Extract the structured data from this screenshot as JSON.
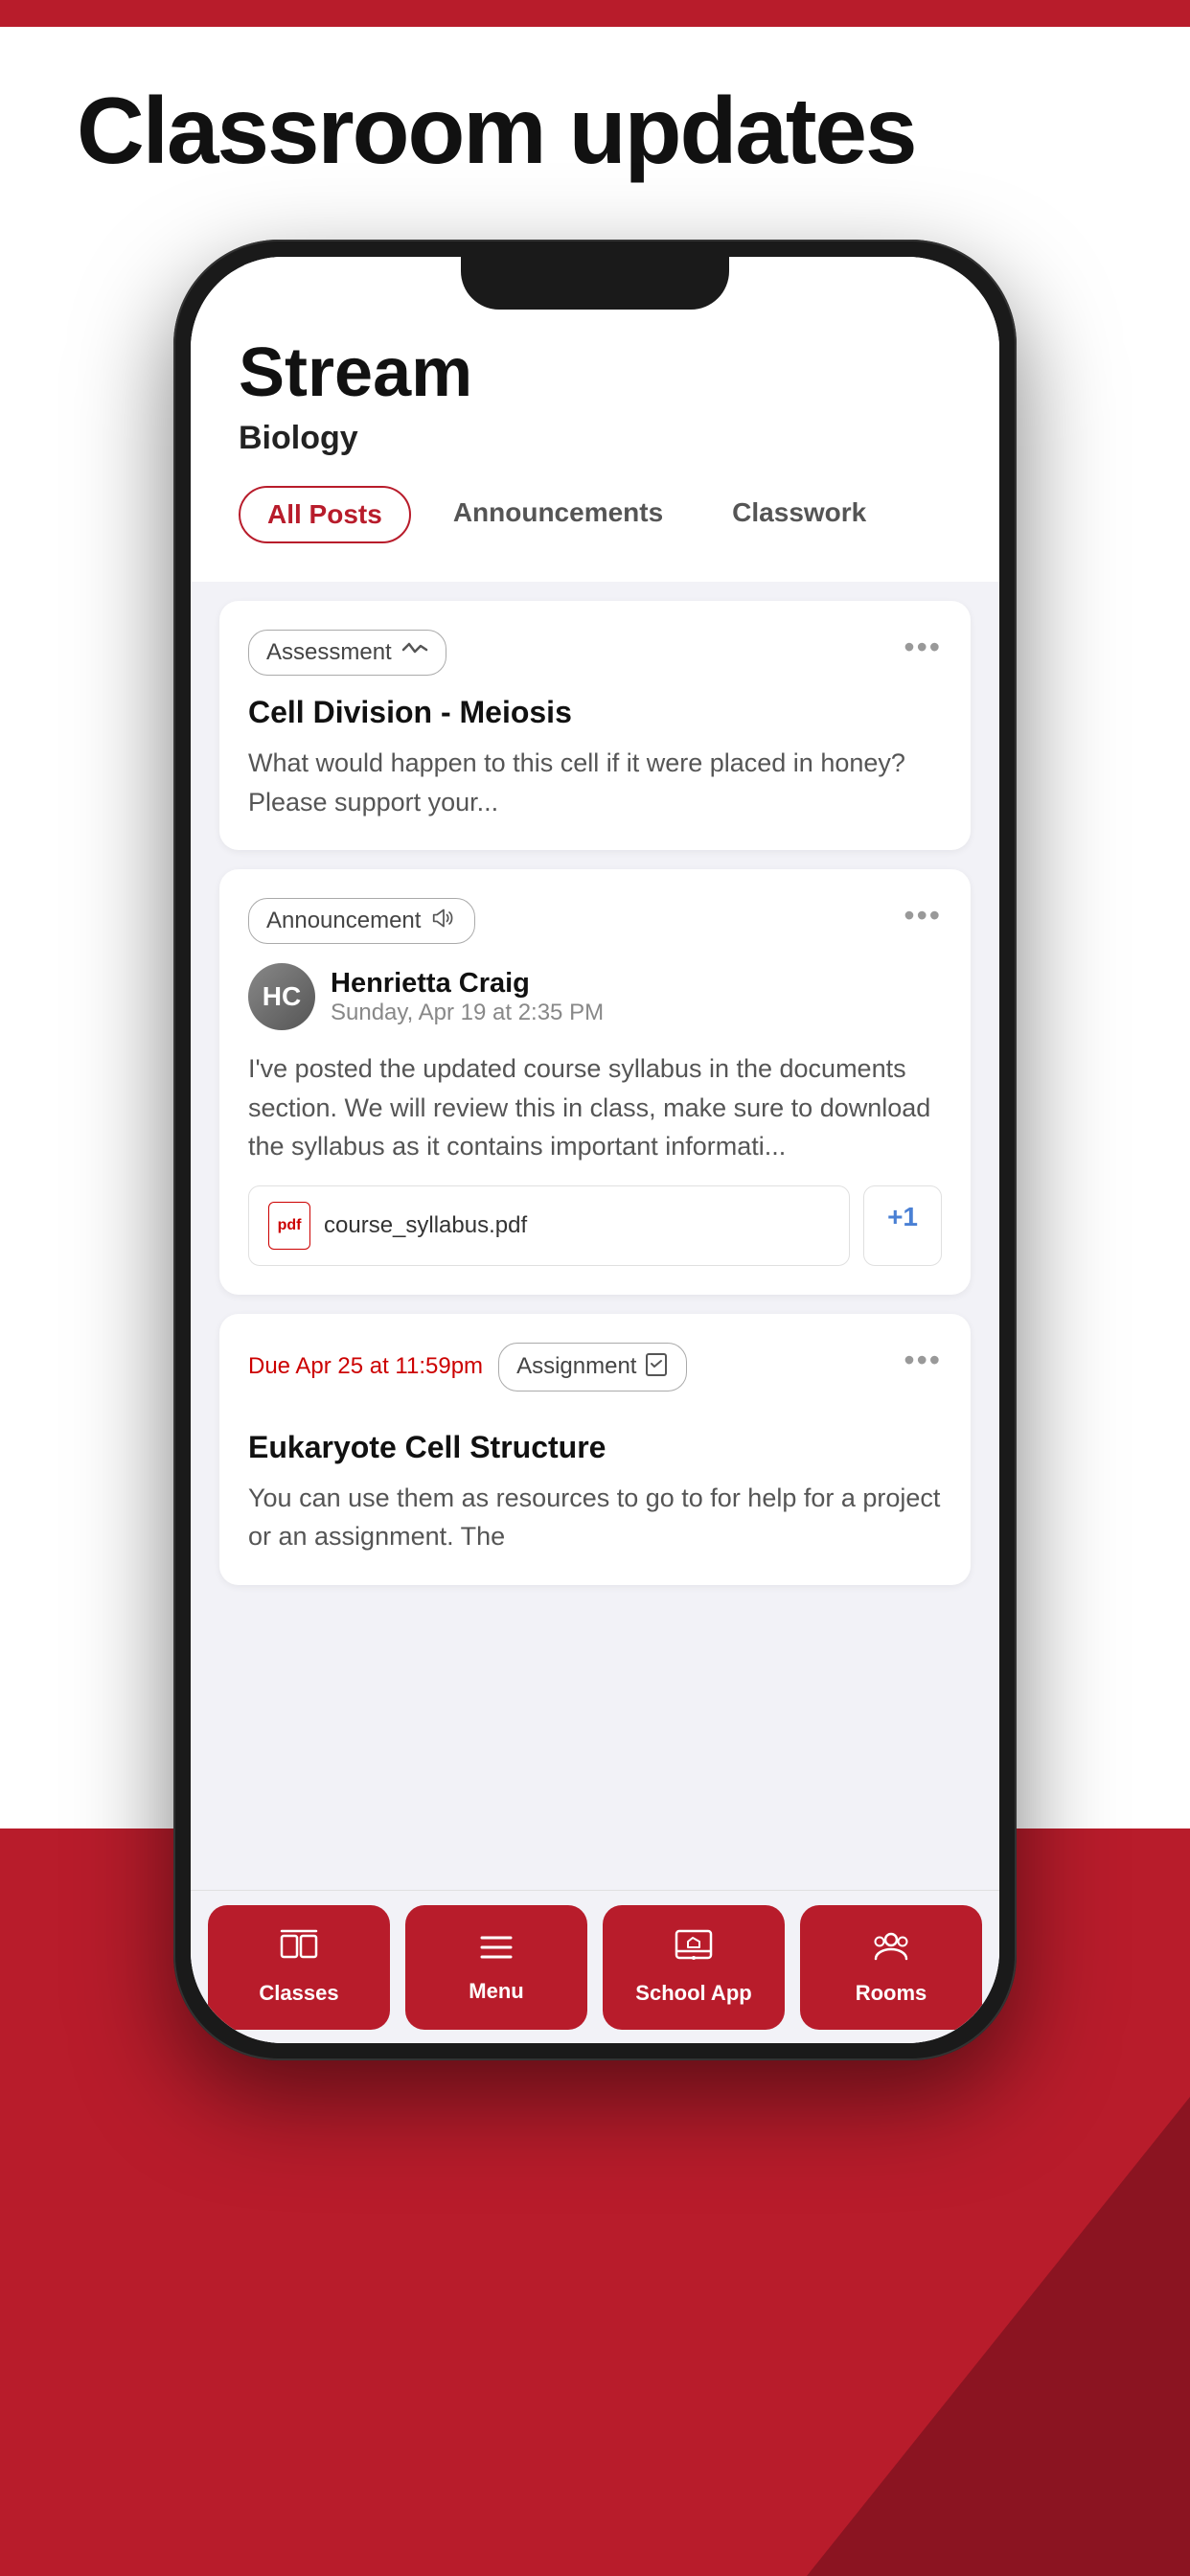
{
  "page": {
    "title": "Classroom updates",
    "background_top_color": "#b81c2b",
    "background_bottom_color": "#b81c2b"
  },
  "phone": {
    "screen": {
      "header": {
        "stream_title": "Stream",
        "class_name": "Biology"
      },
      "filter_tabs": [
        {
          "id": "all_posts",
          "label": "All Posts",
          "active": true
        },
        {
          "id": "announcements",
          "label": "Announcements",
          "active": false
        },
        {
          "id": "classwork",
          "label": "Classwork",
          "active": false
        }
      ],
      "posts": [
        {
          "id": "post1",
          "tag": "Assessment",
          "tag_type": "assessment",
          "title": "Cell Division - Meiosis",
          "body": "What would happen to this cell if it were placed in honey? Please support your...",
          "has_author": false,
          "has_attachment": false,
          "due_date": null
        },
        {
          "id": "post2",
          "tag": "Announcement",
          "tag_type": "announcement",
          "title": null,
          "body": "I've posted the updated course syllabus in the documents section. We will review this in class, make sure to download the syllabus as it contains important informati...",
          "has_author": true,
          "author_name": "Henrietta Craig",
          "author_date": "Sunday, Apr 19 at 2:35 PM",
          "has_attachment": true,
          "attachment_name": "course_syllabus.pdf",
          "attachment_plus": "+1",
          "due_date": null
        },
        {
          "id": "post3",
          "tag": "Assignment",
          "tag_type": "assignment",
          "title": "Eukaryote Cell Structure",
          "body": "You can use them as resources to go to for help for a project or an assignment. The",
          "has_author": false,
          "has_attachment": false,
          "due_date": "Due Apr 25 at 11:59pm"
        }
      ],
      "bottom_nav": [
        {
          "id": "classes",
          "label": "Classes",
          "active": true,
          "icon": "classes"
        },
        {
          "id": "menu",
          "label": "Menu",
          "active": true,
          "icon": "menu"
        },
        {
          "id": "school_app",
          "label": "School App",
          "active": false,
          "icon": "school_app"
        },
        {
          "id": "rooms",
          "label": "Rooms",
          "active": false,
          "icon": "rooms"
        }
      ]
    }
  }
}
